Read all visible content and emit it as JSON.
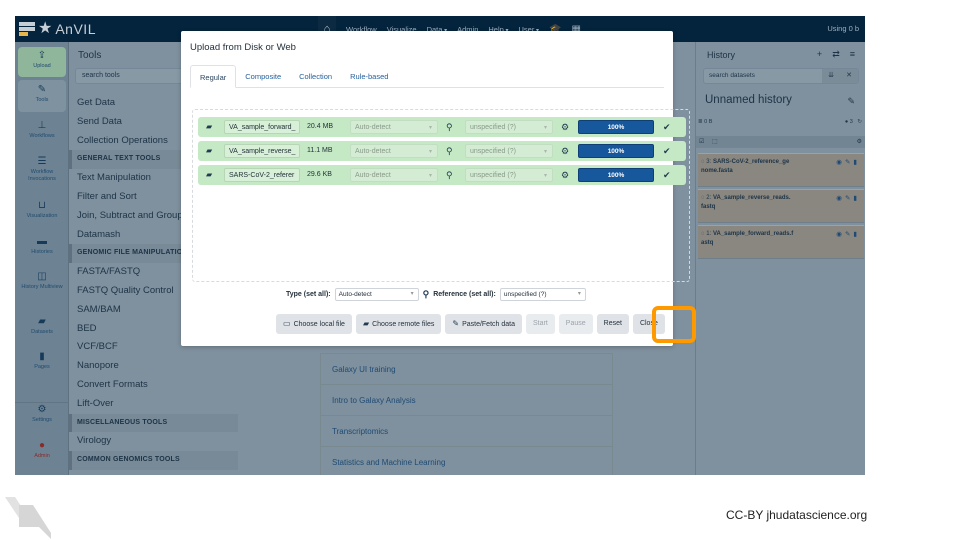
{
  "topnav": {
    "brand": "AnVIL",
    "links": [
      {
        "label": "Workflow",
        "caret": false
      },
      {
        "label": "Visualize",
        "caret": false
      },
      {
        "label": "Data",
        "caret": true
      },
      {
        "label": "Admin",
        "caret": false
      },
      {
        "label": "Help",
        "caret": true
      },
      {
        "label": "User",
        "caret": true
      }
    ],
    "usage": "Using 0 b",
    "icons": [
      "home-icon",
      "graduation-cap-icon",
      "grid-icon"
    ]
  },
  "activity_bar": {
    "items": [
      {
        "label": "Upload",
        "icon": "upload-icon",
        "glyph": "⇪",
        "active": true
      },
      {
        "label": "Tools",
        "icon": "wrench-icon",
        "glyph": "🔧"
      },
      {
        "label": "Workflows",
        "icon": "sitemap-icon",
        "glyph": "品"
      },
      {
        "label": "Workflow Invocations",
        "icon": "list-icon",
        "glyph": "☰"
      },
      {
        "label": "Visualization",
        "icon": "chart-icon",
        "glyph": "📊"
      },
      {
        "label": "Histories",
        "icon": "database-icon",
        "glyph": "▬"
      },
      {
        "label": "History Multiview",
        "icon": "columns-icon",
        "glyph": "◫"
      },
      {
        "label": "Datasets",
        "icon": "folder-icon",
        "glyph": "▰"
      },
      {
        "label": "Pages",
        "icon": "file-icon",
        "glyph": "▮"
      },
      {
        "label": "Settings",
        "icon": "gear-icon",
        "glyph": "⚙"
      },
      {
        "label": "Admin",
        "icon": "user-cog-icon",
        "glyph": "👤"
      }
    ]
  },
  "tool_panel": {
    "title": "Tools",
    "search_placeholder": "search tools",
    "items": [
      {
        "label": "Get Data",
        "section": false
      },
      {
        "label": "Send Data",
        "section": false
      },
      {
        "label": "Collection Operations",
        "section": false
      },
      {
        "label": "GENERAL TEXT TOOLS",
        "section": true
      },
      {
        "label": "Text Manipulation",
        "section": false
      },
      {
        "label": "Filter and Sort",
        "section": false
      },
      {
        "label": "Join, Subtract and Group",
        "section": false
      },
      {
        "label": "Datamash",
        "section": false
      },
      {
        "label": "GENOMIC FILE MANIPULATION",
        "section": true
      },
      {
        "label": "FASTA/FASTQ",
        "section": false
      },
      {
        "label": "FASTQ Quality Control",
        "section": false
      },
      {
        "label": "SAM/BAM",
        "section": false
      },
      {
        "label": "BED",
        "section": false
      },
      {
        "label": "VCF/BCF",
        "section": false
      },
      {
        "label": "Nanopore",
        "section": false
      },
      {
        "label": "Convert Formats",
        "section": false
      },
      {
        "label": "Lift-Over",
        "section": false
      },
      {
        "label": "MISCELLANEOUS TOOLS",
        "section": true
      },
      {
        "label": "Virology",
        "section": false
      },
      {
        "label": "COMMON GENOMICS TOOLS",
        "section": true
      }
    ]
  },
  "center": {
    "tutorials": [
      "Galaxy UI training",
      "Intro to Galaxy Analysis",
      "Transcriptomics",
      "Statistics and Machine Learning"
    ]
  },
  "history": {
    "title": "History",
    "search_placeholder": "search datasets",
    "name": "Unnamed history",
    "size": "0 B",
    "hidden_count": "3",
    "datasets": [
      {
        "hid": "3",
        "name_line1": "SARS-CoV-2_reference_ge",
        "name_line2": "nome.fasta"
      },
      {
        "hid": "2",
        "name_line1": "VA_sample_reverse_reads.",
        "name_line2": "fastq"
      },
      {
        "hid": "1",
        "name_line1": "VA_sample_forward_reads.f",
        "name_line2": "astq"
      }
    ]
  },
  "upload_dialog": {
    "title": "Upload from Disk or Web",
    "tabs": [
      {
        "label": "Regular",
        "active": true
      },
      {
        "label": "Composite"
      },
      {
        "label": "Collection"
      },
      {
        "label": "Rule-based"
      }
    ],
    "files": [
      {
        "name": "VA_sample_forward_",
        "size": "20.4 MB",
        "type": "Auto-detect",
        "reference": "unspecified (?)",
        "progress_percent": 100,
        "progress_label": "100%"
      },
      {
        "name": "VA_sample_reverse_",
        "size": "11.1 MB",
        "type": "Auto-detect",
        "reference": "unspecified (?)",
        "progress_percent": 100,
        "progress_label": "100%"
      },
      {
        "name": "SARS-CoV-2_referer",
        "size": "29.6 KB",
        "type": "Auto-detect",
        "reference": "unspecified (?)",
        "progress_percent": 100,
        "progress_label": "100%"
      }
    ],
    "type_set_all_label": "Type (set all):",
    "type_set_all_value": "Auto-detect",
    "reference_set_all_label": "Reference (set all):",
    "reference_set_all_value": "unspecified (?)",
    "buttons": {
      "choose_local": "Choose local file",
      "choose_remote": "Choose remote files",
      "paste_fetch": "Paste/Fetch data",
      "start": "Start",
      "pause": "Pause",
      "reset": "Reset",
      "close": "Close"
    },
    "highlight_color": "#ff9900"
  },
  "slide": {
    "credit": "CC-BY jhudatascience.org"
  }
}
